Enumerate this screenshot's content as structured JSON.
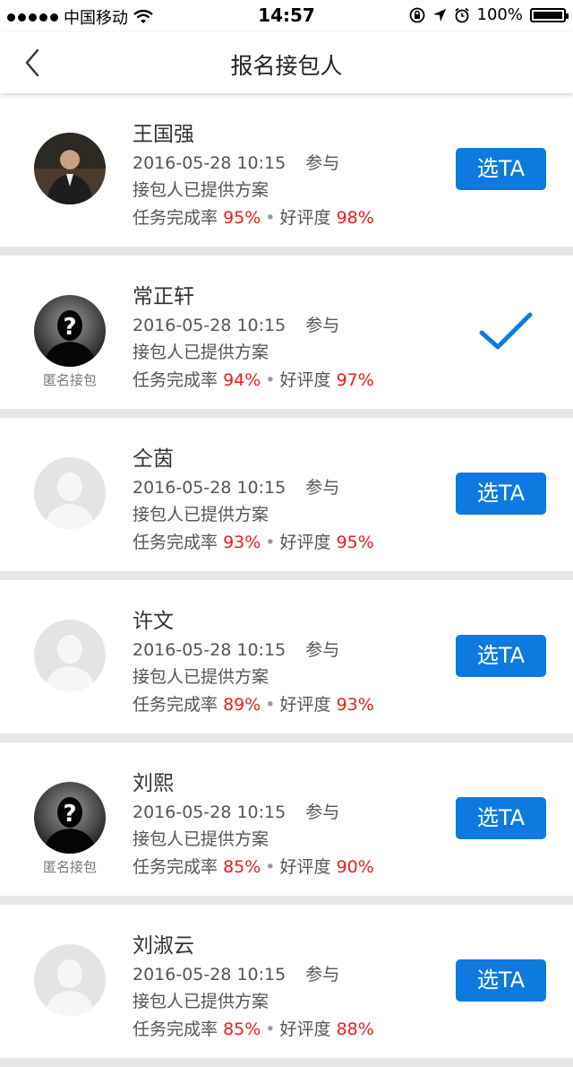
{
  "status_bar": {
    "carrier": "中国移动",
    "time": "14:57",
    "battery": "100%",
    "battery_level": 1.0
  },
  "header": {
    "title": "报名接包人"
  },
  "colors": {
    "accent": "#0e7ae0",
    "rate": "#ee1c1c",
    "divider": "#e6e6e6"
  },
  "labels": {
    "participate": "参与",
    "select": "选TA",
    "rate_label": "任务完成率",
    "praise_label": "好评度",
    "anon": "匿名接包"
  },
  "applicants": [
    {
      "name": "王国强",
      "datetime": "2016-05-28 10:15",
      "status": "接包人已提供方案",
      "completion": "95%",
      "praise": "98%",
      "avatar": "photo",
      "selected": false
    },
    {
      "name": "常正轩",
      "datetime": "2016-05-28 10:15",
      "status": "接包人已提供方案",
      "completion": "94%",
      "praise": "97%",
      "avatar": "anonymous",
      "selected": true
    },
    {
      "name": "仝茵",
      "datetime": "2016-05-28 10:15",
      "status": "接包人已提供方案",
      "completion": "93%",
      "praise": "95%",
      "avatar": "default",
      "selected": false
    },
    {
      "name": "许文",
      "datetime": "2016-05-28 10:15",
      "status": "接包人已提供方案",
      "completion": "89%",
      "praise": "93%",
      "avatar": "default",
      "selected": false
    },
    {
      "name": "刘熙",
      "datetime": "2016-05-28 10:15",
      "status": "接包人已提供方案",
      "completion": "85%",
      "praise": "90%",
      "avatar": "anonymous",
      "selected": false
    },
    {
      "name": "刘淑云",
      "datetime": "2016-05-28 10:15",
      "status": "接包人已提供方案",
      "completion": "85%",
      "praise": "88%",
      "avatar": "default",
      "selected": false
    }
  ]
}
